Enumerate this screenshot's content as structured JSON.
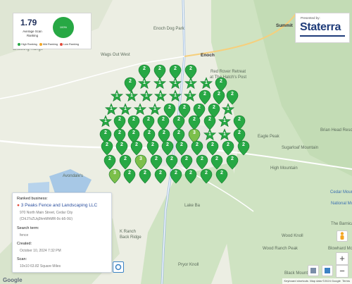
{
  "stats": {
    "average": "1.79",
    "average_label": "Average Scan Ranking",
    "donut_label": "100%",
    "donut_color": "#27a844",
    "legend": [
      {
        "label": "High Ranking",
        "color": "#27a844"
      },
      {
        "label": "Mid Ranking",
        "color": "#f4a623"
      },
      {
        "label": "Low Ranking",
        "color": "#e24b3b"
      }
    ]
  },
  "brand": {
    "presented_by": "Presented by:",
    "name": "Staterra"
  },
  "info": {
    "ranked_business_label": "Ranked business:",
    "business_name": "3 Peaks Fence and Landscaping LLC",
    "address": "970 North Main Street, Cedar City",
    "place_id": "(ChIJ7xZUq3hmMhMR-9c-b5-9U)",
    "search_term_label": "Search term:",
    "search_term": "fence",
    "created_label": "Created:",
    "created": "October 10, 2024 7:32 PM",
    "scan_label": "Scan:",
    "scan": "10x10 63.82 Square Miles"
  },
  "map": {
    "places": [
      {
        "id": "enoch-dog-park",
        "label": "Enoch Dog Park",
        "cls": "place"
      },
      {
        "id": "wags-out-west",
        "label": "Wags Out West",
        "cls": "place"
      },
      {
        "id": "enoch",
        "label": "Enoch",
        "cls": "place town"
      },
      {
        "id": "red-rover",
        "label": "Red Rover Retreat",
        "cls": "place"
      },
      {
        "id": "hatchs-post",
        "label": "at The Hatch's Post",
        "cls": "place"
      },
      {
        "id": "summit",
        "label": "Summit",
        "cls": "place town"
      },
      {
        "id": "shooting-range",
        "label": "Shooting Range",
        "cls": "place"
      },
      {
        "id": "brian-head",
        "label": "Brian Head Resor",
        "cls": "place"
      },
      {
        "id": "eagle-peak",
        "label": "Eagle Peak",
        "cls": "place"
      },
      {
        "id": "sugarloaf",
        "label": "Sugarloaf Mountain",
        "cls": "place"
      },
      {
        "id": "high-mountain",
        "label": "High Mountain",
        "cls": "place"
      },
      {
        "id": "avondales",
        "label": "Avondale's",
        "cls": "place"
      },
      {
        "id": "cedar-mountain",
        "label": "Cedar Mountain",
        "cls": "place blue"
      },
      {
        "id": "national-monument",
        "label": "National Monum",
        "cls": "place blue"
      },
      {
        "id": "the-barnican",
        "label": "The Barnican",
        "cls": "place"
      },
      {
        "id": "wood-knoll",
        "label": "Wood Knoll",
        "cls": "place"
      },
      {
        "id": "wood-ranch-peak",
        "label": "Wood Ranch Peak",
        "cls": "place"
      },
      {
        "id": "blowhard",
        "label": "Blowhard Mountain",
        "cls": "place"
      },
      {
        "id": "pryor-knoll",
        "label": "Pryor Knoll",
        "cls": "place"
      },
      {
        "id": "black-mountain",
        "label": "Black Mountain",
        "cls": "place"
      },
      {
        "id": "k-ranch",
        "label": "K Ranch",
        "cls": "place"
      },
      {
        "id": "back-ridge",
        "label": "Back Ridge",
        "cls": "place"
      },
      {
        "id": "lake-bay",
        "label": "Lake Ba",
        "cls": "place"
      }
    ],
    "pins": [
      {
        "rank": "2",
        "star": false
      },
      {
        "rank": "2",
        "star": false
      },
      {
        "rank": "2",
        "star": false
      },
      {
        "rank": "2",
        "star": false
      },
      {
        "rank": "2",
        "star": false
      },
      {
        "rank": "1",
        "star": true
      },
      {
        "rank": "1",
        "star": true
      },
      {
        "rank": "1",
        "star": true
      },
      {
        "rank": "1",
        "star": true
      },
      {
        "rank": "1",
        "star": true
      },
      {
        "rank": "2",
        "star": false
      },
      {
        "rank": "1",
        "star": true
      },
      {
        "rank": "1",
        "star": true
      },
      {
        "rank": "1",
        "star": true
      },
      {
        "rank": "1",
        "star": true
      },
      {
        "rank": "1",
        "star": true
      },
      {
        "rank": "1",
        "star": true
      },
      {
        "rank": "2",
        "star": false
      },
      {
        "rank": "2",
        "star": false
      },
      {
        "rank": "2",
        "star": false
      },
      {
        "rank": "1",
        "star": true
      },
      {
        "rank": "1",
        "star": true
      },
      {
        "rank": "1",
        "star": true
      },
      {
        "rank": "1",
        "star": true
      },
      {
        "rank": "2",
        "star": false
      },
      {
        "rank": "2",
        "star": false
      },
      {
        "rank": "2",
        "star": false
      },
      {
        "rank": "2",
        "star": false
      },
      {
        "rank": "1",
        "star": true
      },
      {
        "rank": "1",
        "star": true
      },
      {
        "rank": "2",
        "star": false
      },
      {
        "rank": "2",
        "star": false
      },
      {
        "rank": "2",
        "star": false
      },
      {
        "rank": "2",
        "star": false
      },
      {
        "rank": "2",
        "star": false
      },
      {
        "rank": "2",
        "star": false
      },
      {
        "rank": "2",
        "star": false
      },
      {
        "rank": "1",
        "star": true
      },
      {
        "rank": "2",
        "star": false
      },
      {
        "rank": "2",
        "star": false
      },
      {
        "rank": "2",
        "star": false
      },
      {
        "rank": "2",
        "star": false
      },
      {
        "rank": "2",
        "star": false
      },
      {
        "rank": "2",
        "star": false
      },
      {
        "rank": "2",
        "star": false
      },
      {
        "rank": "3",
        "star": false
      },
      {
        "rank": "1",
        "star": true
      },
      {
        "rank": "1",
        "star": true
      },
      {
        "rank": "2",
        "star": false
      },
      {
        "rank": "2",
        "star": false
      },
      {
        "rank": "2",
        "star": false
      },
      {
        "rank": "2",
        "star": false
      },
      {
        "rank": "2",
        "star": false
      },
      {
        "rank": "2",
        "star": false
      },
      {
        "rank": "2",
        "star": false
      },
      {
        "rank": "2",
        "star": false
      },
      {
        "rank": "2",
        "star": false
      },
      {
        "rank": "2",
        "star": false
      },
      {
        "rank": "2",
        "star": false
      },
      {
        "rank": "2",
        "star": false
      },
      {
        "rank": "2",
        "star": false
      },
      {
        "rank": "3",
        "star": false
      },
      {
        "rank": "2",
        "star": false
      },
      {
        "rank": "2",
        "star": false
      },
      {
        "rank": "2",
        "star": false
      },
      {
        "rank": "2",
        "star": false
      },
      {
        "rank": "2",
        "star": false
      },
      {
        "rank": "2",
        "star": false
      },
      {
        "rank": "3",
        "star": false
      },
      {
        "rank": "2",
        "star": false
      },
      {
        "rank": "2",
        "star": false
      },
      {
        "rank": "2",
        "star": false
      },
      {
        "rank": "2",
        "star": false
      },
      {
        "rank": "2",
        "star": false
      },
      {
        "rank": "2",
        "star": false
      },
      {
        "rank": "2",
        "star": false
      }
    ],
    "pin_color": "#27a844",
    "pin_color_light": "#7cbf4a"
  },
  "controls": {
    "zoom_in": "+",
    "zoom_out": "−"
  },
  "footer": {
    "google": "Google",
    "shortcuts": "Keyboard shortcuts",
    "map_data": "Map data ©2024 Google",
    "terms": "Terms"
  }
}
